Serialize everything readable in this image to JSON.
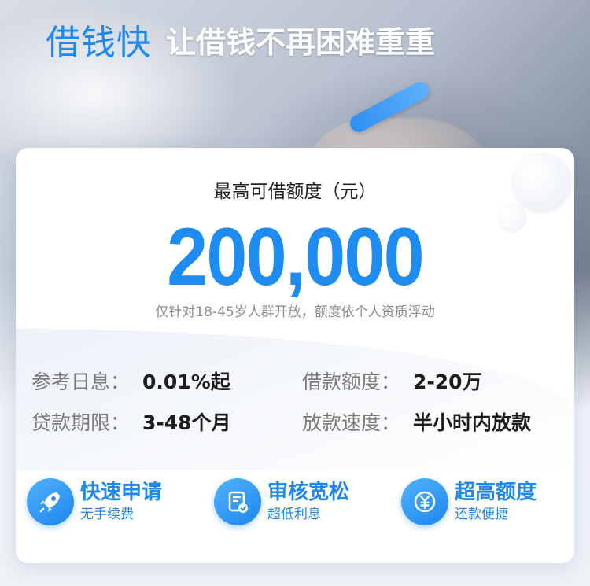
{
  "header": {
    "brand": "借钱快",
    "slogan": "让借钱不再困难重重"
  },
  "card": {
    "limit_label": "最高可借额度（元）",
    "amount": "200,000",
    "note": "仅针对18-45岁人群开放，额度依个人资质浮动",
    "info": [
      {
        "label": "参考日息：",
        "value": "0.01%起"
      },
      {
        "label": "借款额度：",
        "value": "2-20万"
      },
      {
        "label": "贷款期限：",
        "value": "3-48个月"
      },
      {
        "label": "放款速度：",
        "value": "半小时内放款"
      }
    ]
  },
  "features": [
    {
      "icon": "rocket-icon",
      "title": "快速申请",
      "subtitle": "无手续费"
    },
    {
      "icon": "document-check-icon",
      "title": "审核宽松",
      "subtitle": "超低利息"
    },
    {
      "icon": "yuan-coin-icon",
      "title": "超高额度",
      "subtitle": "还款便捷"
    }
  ],
  "colors": {
    "accent": "#1e88ec",
    "amount": "#1f8cf1",
    "text_dark": "#1d1d1d",
    "text_muted": "#8c8c8c"
  }
}
